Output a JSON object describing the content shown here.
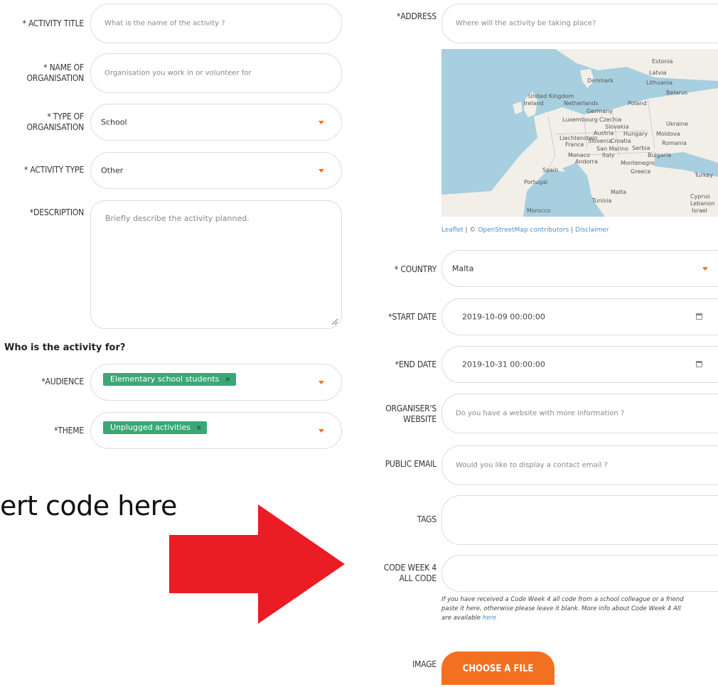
{
  "left": {
    "activity_title": {
      "label": "* ACTIVITY TITLE",
      "placeholder": "What is the name of the activity ?"
    },
    "organisation_name": {
      "label_line1": "* NAME OF",
      "label_line2": "ORGANISATION",
      "placeholder": "Organisation you work in or volunteer for"
    },
    "organisation_type": {
      "label_line1": "* TYPE OF",
      "label_line2": "ORGANISATION",
      "value": "School"
    },
    "activity_type": {
      "label": "* ACTIVITY TYPE",
      "value": "Other"
    },
    "description": {
      "label": "*DESCRIPTION",
      "placeholder": "Briefly describe the activity planned."
    },
    "section_title": "Who is the activity for?",
    "audience": {
      "label": "*AUDIENCE",
      "tag": "Elementary school students"
    },
    "theme": {
      "label": "*THEME",
      "tag": "Unplugged activities"
    }
  },
  "overlay": {
    "text": "ert code here",
    "arrow_color": "#ea1c24"
  },
  "right": {
    "address": {
      "label": "*ADDRESS",
      "placeholder": "Where will the activity be taking place?"
    },
    "map": {
      "attribution_leaflet": "Leaflet",
      "attribution_sep1": " | © ",
      "attribution_osm": "OpenStreetMap contributors",
      "attribution_sep2": " | ",
      "attribution_disclaimer": "Disclaimer",
      "places": {
        "estonia": "Estonia",
        "latvia": "Latvia",
        "lithuania": "Lithuania",
        "belarus": "Belarus",
        "denmark": "Denmark",
        "uk_line1": "United Kingdom",
        "ireland": "Ireland",
        "netherlands": "Netherlands",
        "poland": "Poland",
        "germany": "Germany",
        "luxembourg": "Luxembourg",
        "czechia": "Czechia",
        "slovakia": "Slovakia",
        "ukraine": "Ukraine",
        "austria": "Austria",
        "hungary": "Hungary",
        "moldova": "Moldova",
        "liechtenstein": "Liechtenstein",
        "france": "France",
        "slovenia": "Slovenia",
        "croatia": "Croatia",
        "romania": "Romania",
        "san_marino": "San Marino",
        "serbia": "Serbia",
        "monaco": "Monaco",
        "italy": "Italy",
        "bulgaria": "Bulgaria",
        "andorra": "Andorra",
        "montenegro": "Montenegro",
        "spain": "Spain",
        "greece": "Greece",
        "turkey": "Turkey",
        "portugal": "Portugal",
        "malta": "Malta",
        "tunisia": "Tunisia",
        "cyprus": "Cyprus",
        "lebanon": "Lebanon",
        "israel": "Israel",
        "morocco": "Morocco"
      }
    },
    "country": {
      "label": "* COUNTRY",
      "value": "Malta"
    },
    "start_date": {
      "label": "*START DATE",
      "value": "2019-10-09 00:00:00"
    },
    "end_date": {
      "label": "*END DATE",
      "value": "2019-10-31 00:00:00"
    },
    "website": {
      "label_line1": "ORGANISER'S",
      "label_line2": "WEBSITE",
      "placeholder": "Do you have a website with more information ?"
    },
    "public_email": {
      "label": "PUBLIC EMAIL",
      "placeholder": "Would you like to display a contact email ?"
    },
    "tags": {
      "label": "TAGS"
    },
    "code": {
      "label_line1": "CODE WEEK 4",
      "label_line2": "ALL CODE",
      "help_line1": "If you have received a Code Week 4 all code from a school colleague or a friend",
      "help_line2": "paste it here, otherwise please leave it blank. More info about Code Week 4 All",
      "help_line3_pre": "are available ",
      "help_link": "here"
    },
    "image": {
      "label": "IMAGE",
      "button": "CHOOSE A FILE"
    }
  },
  "colors": {
    "accent": "#f37021",
    "tag_green": "#3aa876",
    "link": "#4a90c8",
    "border": "#dcdcdc"
  }
}
